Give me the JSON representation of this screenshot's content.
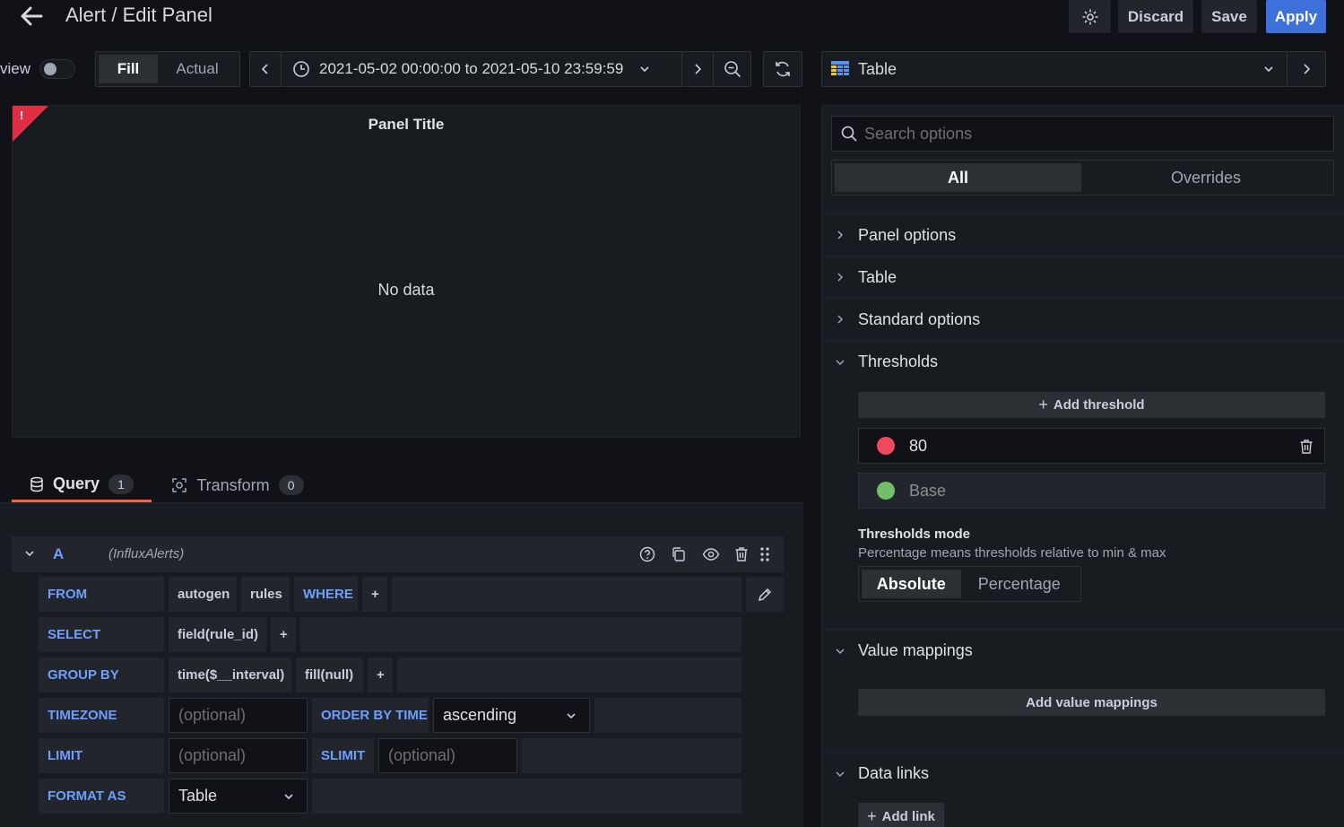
{
  "header": {
    "title": "Alert / Edit Panel",
    "discard_label": "Discard",
    "save_label": "Save",
    "apply_label": "Apply"
  },
  "toolbar": {
    "view_label": "view",
    "fill_label": "Fill",
    "actual_label": "Actual",
    "time_range": "2021-05-02 00:00:00 to 2021-05-10 23:59:59"
  },
  "viz_picker": {
    "label": "Table"
  },
  "panel": {
    "title": "Panel Title",
    "no_data": "No data",
    "alert_badge": "!"
  },
  "tabs": {
    "query_label": "Query",
    "query_count": "1",
    "transform_label": "Transform",
    "transform_count": "0"
  },
  "query": {
    "ref_id": "A",
    "datasource": "(InfluxAlerts)",
    "from": {
      "keyword": "FROM",
      "policy": "autogen",
      "measurement": "rules",
      "where": "WHERE",
      "plus": "+"
    },
    "select": {
      "keyword": "SELECT",
      "field": "field(rule_id)",
      "plus": "+"
    },
    "group_by": {
      "keyword": "GROUP BY",
      "time": "time($__interval)",
      "fill": "fill(null)",
      "plus": "+"
    },
    "timezone": {
      "keyword": "TIMEZONE",
      "placeholder": "(optional)",
      "order_keyword": "ORDER BY TIME",
      "order_value": "ascending"
    },
    "limit": {
      "keyword": "LIMIT",
      "placeholder": "(optional)",
      "slimit_keyword": "SLIMIT",
      "slimit_placeholder": "(optional)"
    },
    "format_as": {
      "keyword": "FORMAT AS",
      "value": "Table"
    }
  },
  "options": {
    "search_placeholder": "Search options",
    "tab_all": "All",
    "tab_overrides": "Overrides",
    "sections": {
      "panel_options": "Panel options",
      "table": "Table",
      "standard_options": "Standard options",
      "thresholds": "Thresholds",
      "value_mappings": "Value mappings",
      "data_links": "Data links"
    },
    "thresholds": {
      "add_label": "Add threshold",
      "value_80": "80",
      "base": "Base",
      "mode_title": "Thresholds mode",
      "mode_desc": "Percentage means thresholds relative to min & max",
      "absolute": "Absolute",
      "percentage": "Percentage",
      "colors": {
        "red": "#f2495c",
        "green": "#73bf69"
      }
    },
    "value_mappings_add": "Add value mappings",
    "data_links_add": "Add link"
  },
  "colors": {
    "accent": "#3d71d9",
    "keyword": "#6e9fff",
    "tab_underline": "#ff5e3a",
    "alert": "#e02f44"
  }
}
